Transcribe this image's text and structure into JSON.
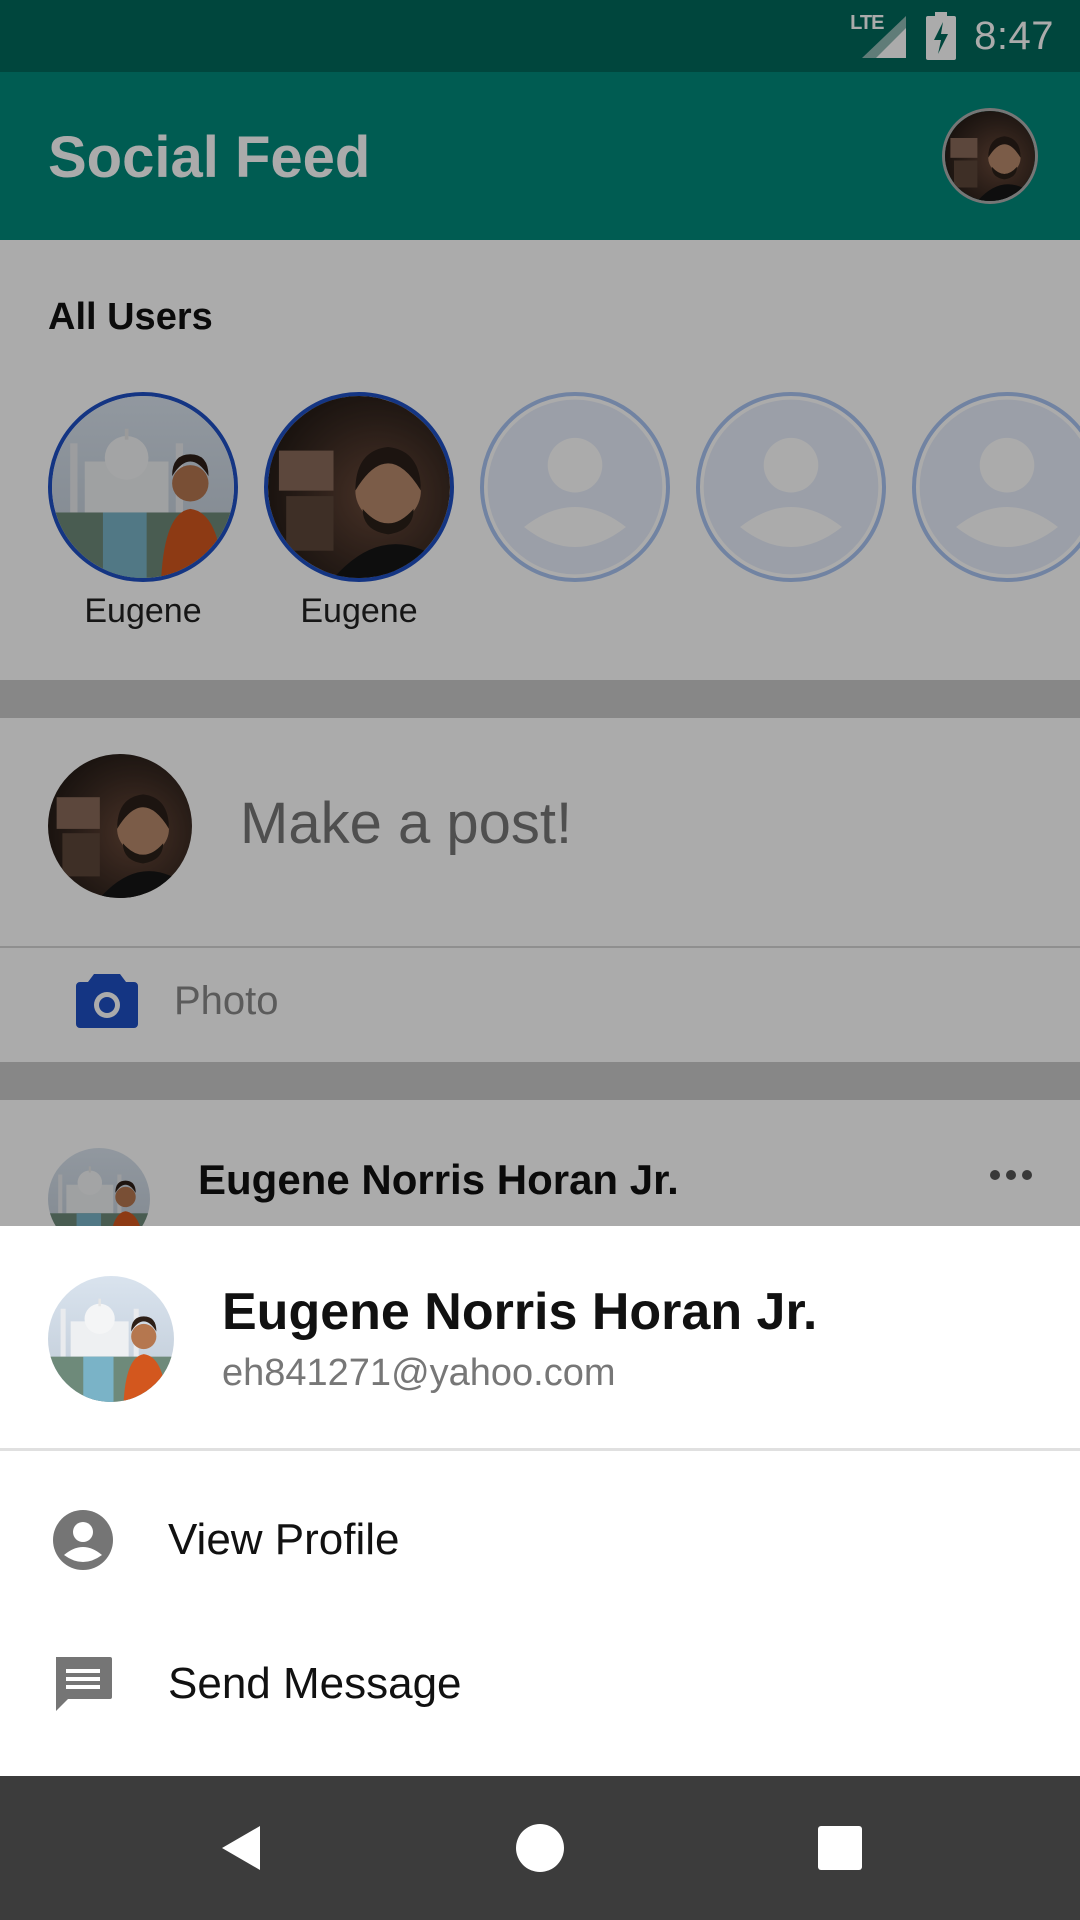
{
  "status_bar": {
    "network": "LTE",
    "time": "8:47",
    "icons": [
      "signal-icon",
      "battery-charging-icon"
    ]
  },
  "app_bar": {
    "title": "Social Feed"
  },
  "users_section": {
    "title": "All Users",
    "users": [
      {
        "name": "Eugene",
        "avatar": "photo"
      },
      {
        "name": "Eugene",
        "avatar": "photo"
      },
      {
        "name": "",
        "avatar": "placeholder"
      },
      {
        "name": "",
        "avatar": "placeholder"
      },
      {
        "name": "",
        "avatar": "placeholder"
      }
    ]
  },
  "composer": {
    "placeholder": "Make a post!",
    "photo_label": "Photo"
  },
  "feed": {
    "post_author": "Eugene Norris Horan Jr."
  },
  "bottom_sheet": {
    "name": "Eugene Norris Horan Jr.",
    "email": "eh841271@yahoo.com",
    "actions": [
      {
        "label": "View Profile",
        "icon": "account-circle-icon"
      },
      {
        "label": "Send Message",
        "icon": "message-icon"
      }
    ]
  },
  "nav_bar": {
    "buttons": [
      "back-icon",
      "home-icon",
      "recents-icon"
    ]
  },
  "colors": {
    "primary": "#00897b",
    "primary_dark": "#00695c",
    "accent": "#1e4fc4",
    "scrim": "rgba(0,0,0,0.33)"
  }
}
